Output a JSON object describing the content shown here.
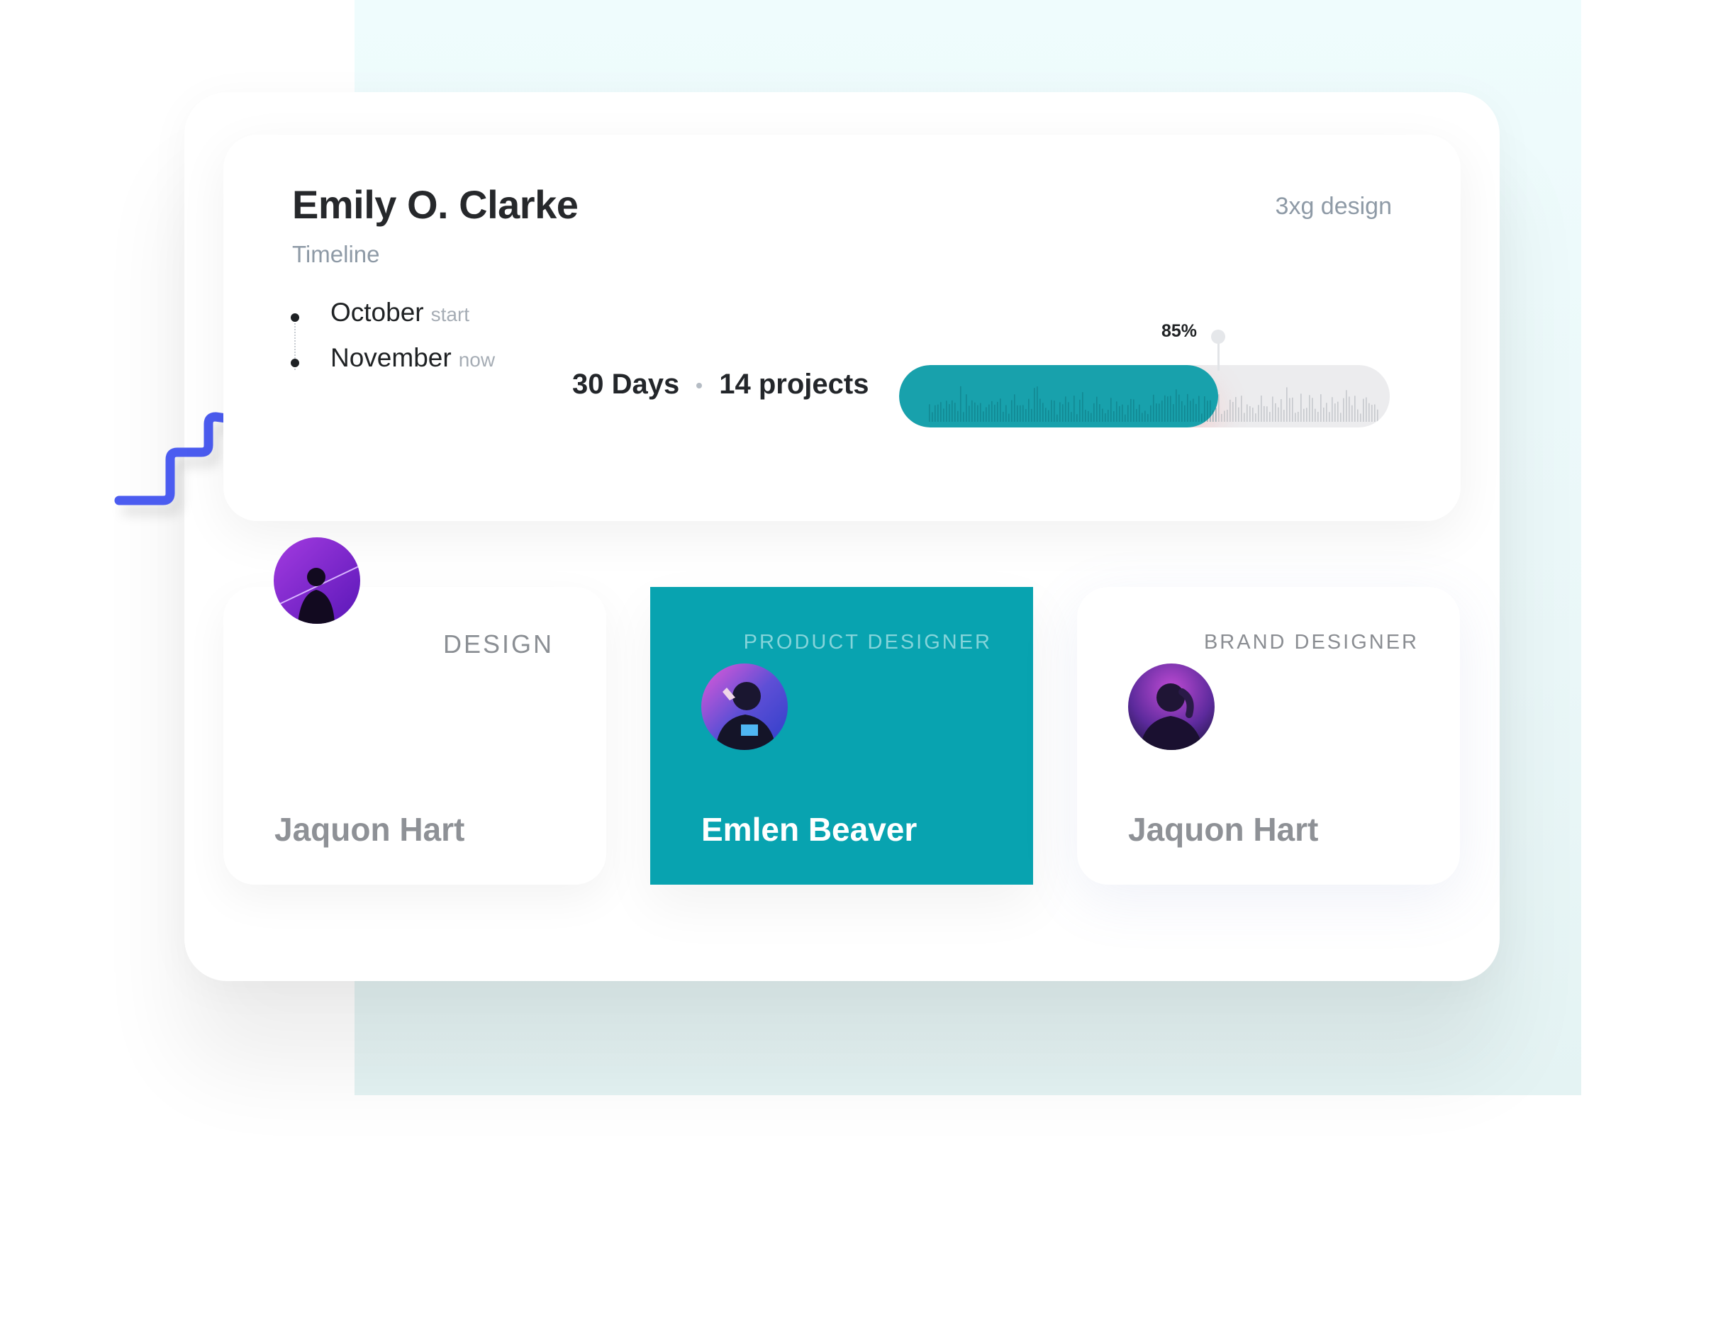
{
  "profile": {
    "name": "Emily O. Clarke",
    "subtitle": "Timeline",
    "brand": "3xg design"
  },
  "timeline": [
    {
      "month": "October",
      "tag": "start"
    },
    {
      "month": "November",
      "tag": "now"
    }
  ],
  "stats": {
    "days": "30 Days",
    "projects": "14 projects"
  },
  "progress": {
    "percent": 85,
    "label": "85%",
    "fill_fraction": 0.65
  },
  "colors": {
    "accent": "#08a3b0",
    "fill": "#18a1ac",
    "squiggle": "#4b5cf0",
    "muted_text": "#8e9aa6"
  },
  "icons": {
    "squiggle": "squiggle-decoration-icon",
    "timeline_dot": "bullet-dot-icon"
  },
  "people": [
    {
      "role": "DESIGN",
      "name": "Jaquon Hart"
    },
    {
      "role": "PRODUCT DESIGNER",
      "name": "Emlen Beaver"
    },
    {
      "role": "BRAND DESIGNER",
      "name": "Jaquon Hart"
    }
  ]
}
